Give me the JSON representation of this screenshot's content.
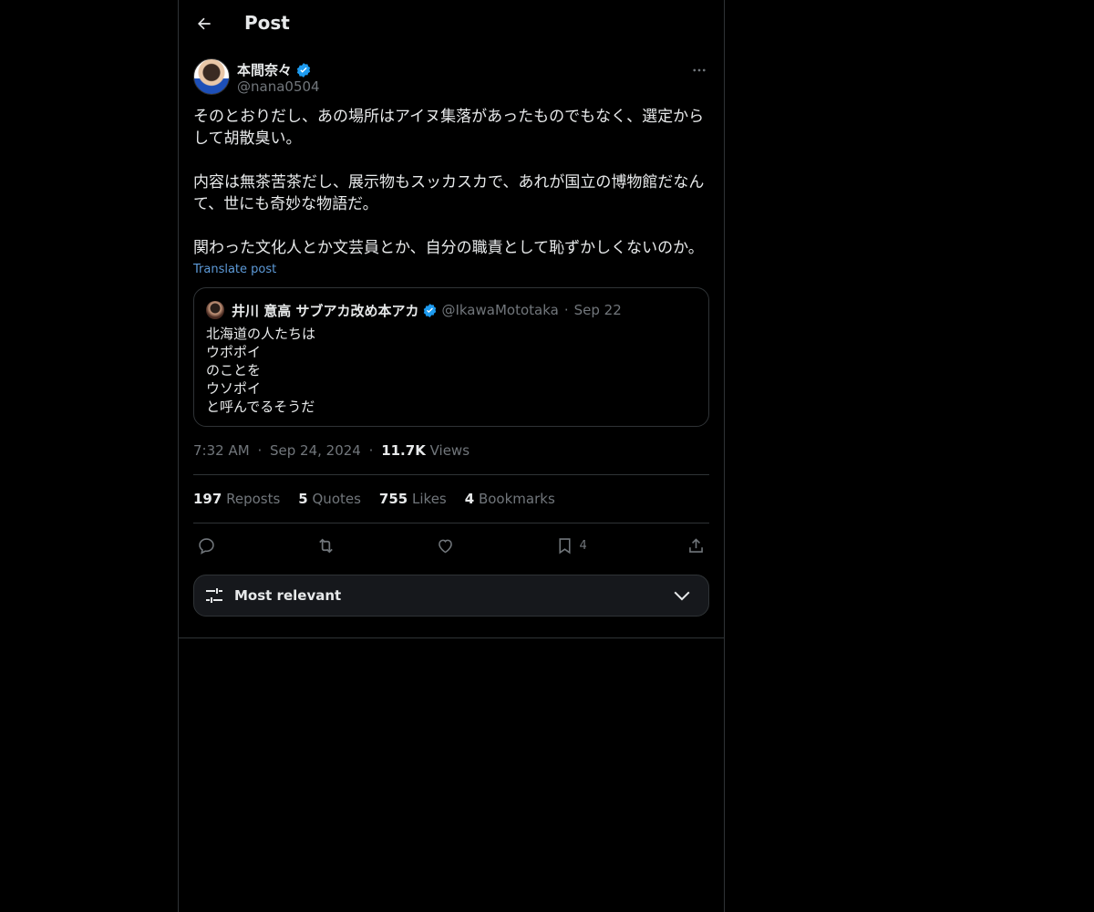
{
  "header": {
    "title": "Post",
    "back_icon": "arrow-left-icon"
  },
  "author": {
    "name": "本間奈々",
    "handle": "@nana0504",
    "verified": true,
    "verified_color": "#1d9bf0"
  },
  "post": {
    "text": "そのとおりだし、あの場所はアイヌ集落があったものでもなく、選定から\nして胡散臭い。\n\n内容は無茶苦茶だし、展示物もスッカスカで、あれが国立の博物館だなん\nて、世にも奇妙な物語だ。\n\n関わった文化人とか文芸員とか、自分の職責として恥ずかしくないのか。",
    "translate_label": "Translate post"
  },
  "quote": {
    "name": "井川 意高 サブアカ改め本アカ",
    "handle": "@IkawaMototaka",
    "dot": "·",
    "date": "Sep 22",
    "text": "北海道の人たちは\nウポポイ\nのことを\nウソポイ\nと呼んでるそうだ"
  },
  "meta": {
    "time": "7:32 AM",
    "sep1": "·",
    "date": "Sep 24, 2024",
    "sep2": "·",
    "views_count": "11.7K",
    "views_label": "Views"
  },
  "stats": {
    "reposts_count": "197",
    "reposts_label": "Reposts",
    "quotes_count": "5",
    "quotes_label": "Quotes",
    "likes_count": "755",
    "likes_label": "Likes",
    "bookmarks_count": "4",
    "bookmarks_label": "Bookmarks"
  },
  "actions": {
    "reply_icon": "reply-icon",
    "repost_icon": "repost-icon",
    "like_icon": "heart-icon",
    "bookmark_icon": "bookmark-icon",
    "bookmark_count": "4",
    "share_icon": "share-icon"
  },
  "sort": {
    "label": "Most relevant",
    "icon": "sliders-icon",
    "chevron": "chevron-down-icon"
  },
  "colors": {
    "background": "#000000",
    "text": "#e7e9ea",
    "muted": "#71767b",
    "link": "#5d9ad8",
    "border": "#2f3336",
    "verified": "#1d9bf0"
  }
}
